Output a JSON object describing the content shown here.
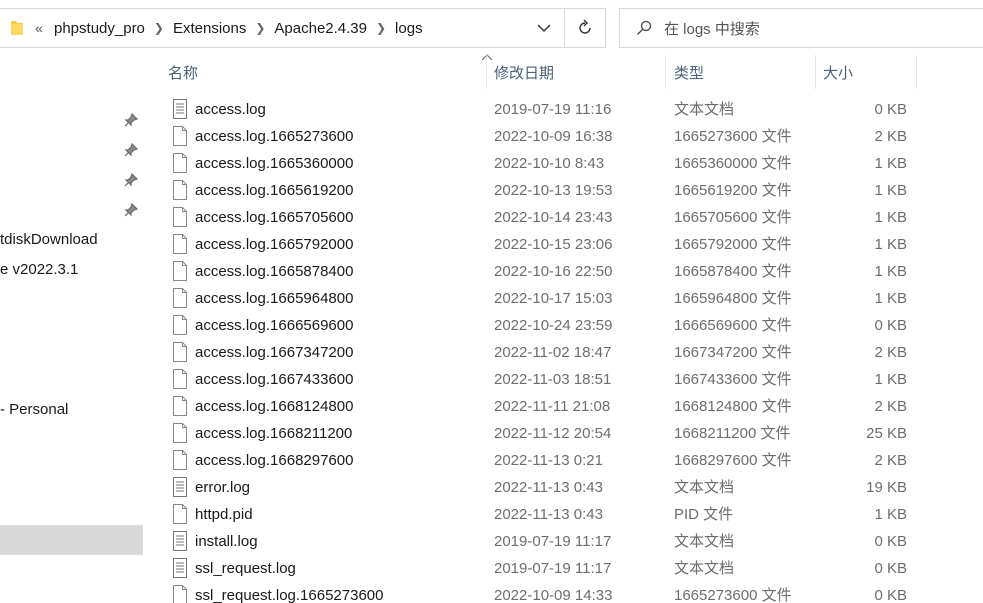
{
  "addressbar": {
    "overflow_chevron": "«",
    "crumbs": [
      "phpstudy_pro",
      "Extensions",
      "Apache2.4.39",
      "logs"
    ]
  },
  "search": {
    "placeholder": "在 logs 中搜索"
  },
  "nav": {
    "items": [
      "tdiskDownload",
      "e v2022.3.1",
      "- Personal"
    ]
  },
  "columns": {
    "name": "名称",
    "date": "修改日期",
    "type": "类型",
    "size": "大小"
  },
  "files": [
    {
      "name": "access.log",
      "date": "2019-07-19 11:16",
      "type": "文本文档",
      "size": "0 KB",
      "icon": "text-file-icon"
    },
    {
      "name": "access.log.1665273600",
      "date": "2022-10-09 16:38",
      "type": "1665273600 文件",
      "size": "2 KB",
      "icon": "blank-file-icon"
    },
    {
      "name": "access.log.1665360000",
      "date": "2022-10-10 8:43",
      "type": "1665360000 文件",
      "size": "1 KB",
      "icon": "blank-file-icon"
    },
    {
      "name": "access.log.1665619200",
      "date": "2022-10-13 19:53",
      "type": "1665619200 文件",
      "size": "1 KB",
      "icon": "blank-file-icon"
    },
    {
      "name": "access.log.1665705600",
      "date": "2022-10-14 23:43",
      "type": "1665705600 文件",
      "size": "1 KB",
      "icon": "blank-file-icon"
    },
    {
      "name": "access.log.1665792000",
      "date": "2022-10-15 23:06",
      "type": "1665792000 文件",
      "size": "1 KB",
      "icon": "blank-file-icon"
    },
    {
      "name": "access.log.1665878400",
      "date": "2022-10-16 22:50",
      "type": "1665878400 文件",
      "size": "1 KB",
      "icon": "blank-file-icon"
    },
    {
      "name": "access.log.1665964800",
      "date": "2022-10-17 15:03",
      "type": "1665964800 文件",
      "size": "1 KB",
      "icon": "blank-file-icon"
    },
    {
      "name": "access.log.1666569600",
      "date": "2022-10-24 23:59",
      "type": "1666569600 文件",
      "size": "0 KB",
      "icon": "blank-file-icon"
    },
    {
      "name": "access.log.1667347200",
      "date": "2022-11-02 18:47",
      "type": "1667347200 文件",
      "size": "2 KB",
      "icon": "blank-file-icon"
    },
    {
      "name": "access.log.1667433600",
      "date": "2022-11-03 18:51",
      "type": "1667433600 文件",
      "size": "1 KB",
      "icon": "blank-file-icon"
    },
    {
      "name": "access.log.1668124800",
      "date": "2022-11-11 21:08",
      "type": "1668124800 文件",
      "size": "2 KB",
      "icon": "blank-file-icon"
    },
    {
      "name": "access.log.1668211200",
      "date": "2022-11-12 20:54",
      "type": "1668211200 文件",
      "size": "25 KB",
      "icon": "blank-file-icon"
    },
    {
      "name": "access.log.1668297600",
      "date": "2022-11-13 0:21",
      "type": "1668297600 文件",
      "size": "2 KB",
      "icon": "blank-file-icon"
    },
    {
      "name": "error.log",
      "date": "2022-11-13 0:43",
      "type": "文本文档",
      "size": "19 KB",
      "icon": "text-file-icon"
    },
    {
      "name": "httpd.pid",
      "date": "2022-11-13 0:43",
      "type": "PID 文件",
      "size": "1 KB",
      "icon": "blank-file-icon"
    },
    {
      "name": "install.log",
      "date": "2019-07-19 11:17",
      "type": "文本文档",
      "size": "0 KB",
      "icon": "text-file-icon"
    },
    {
      "name": "ssl_request.log",
      "date": "2019-07-19 11:17",
      "type": "文本文档",
      "size": "0 KB",
      "icon": "text-file-icon"
    },
    {
      "name": "ssl_request.log.1665273600",
      "date": "2022-10-09 14:33",
      "type": "1665273600 文件",
      "size": "0 KB",
      "icon": "blank-file-icon"
    }
  ]
}
